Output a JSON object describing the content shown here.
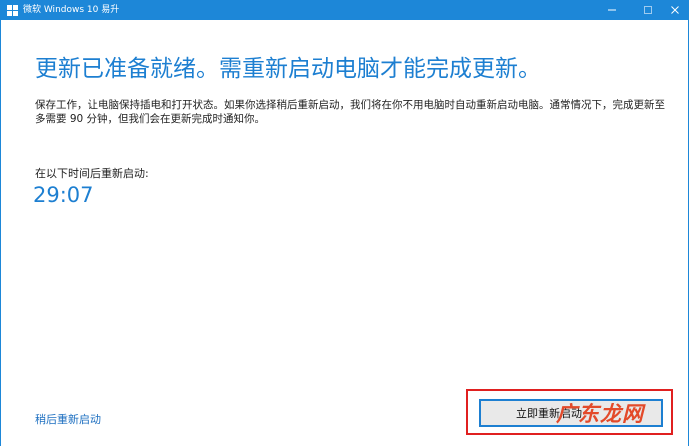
{
  "window": {
    "title": "微软 Windows 10 易升",
    "accent_color": "#1d87d8",
    "controls": {
      "minimize_icon": "minimize-icon",
      "maximize_icon": "maximize-icon",
      "close_icon": "close-icon"
    }
  },
  "main": {
    "heading": "更新已准备就绪。需重新启动电脑才能完成更新。",
    "description": "保存工作，让电脑保持插电和打开状态。如果你选择稍后重新启动，我们将在你不用电脑时自动重新启动电脑。通常情况下，完成更新至多需要 90 分钟，但我们会在更新完成时通知你。",
    "countdown_label": "在以下时间后重新启动:",
    "countdown_value": "29:07"
  },
  "footer": {
    "restart_later_label": "稍后重新启动",
    "restart_now_label": "立即重新启动",
    "watermark_text": "广东龙网"
  },
  "colors": {
    "heading": "#1d7fd1",
    "highlight": "#e02020",
    "watermark": "#e34a2a"
  }
}
